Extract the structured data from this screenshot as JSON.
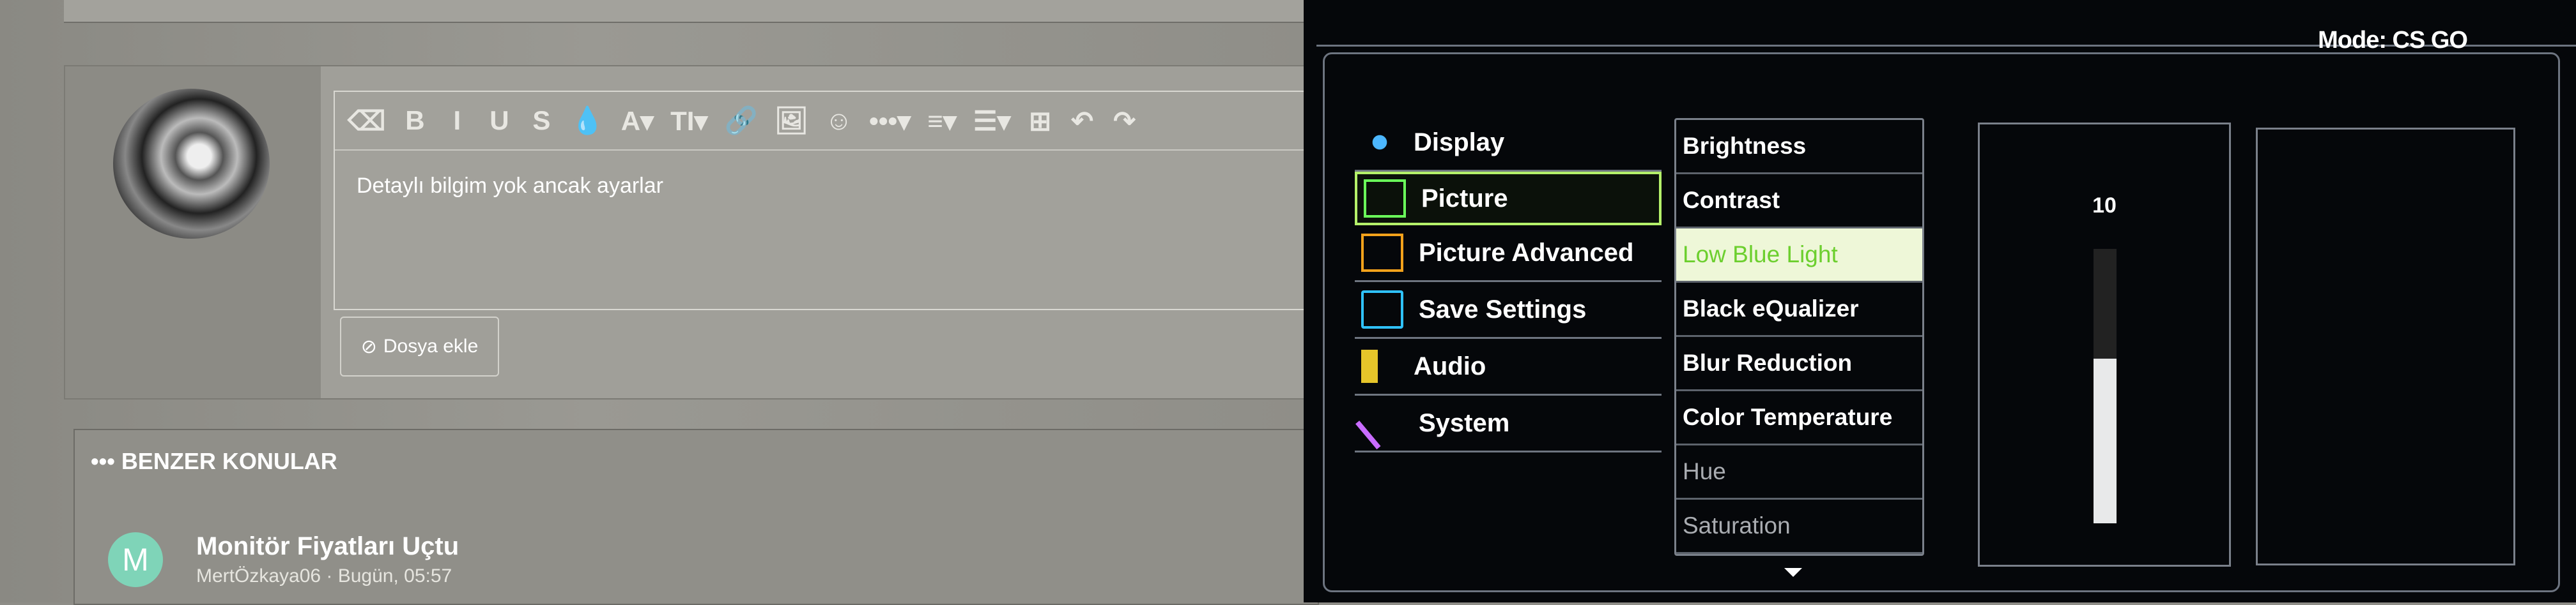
{
  "forum": {
    "editor_text": "Detaylı bilgim yok ancak ayarlar",
    "toolbar": [
      "⌫",
      "B",
      "I",
      "U",
      "S",
      "💧",
      "A▾",
      "TI▾",
      "🔗",
      "🖼",
      "☺",
      "•••▾",
      "≡▾",
      "☰▾",
      "⊞",
      "↶",
      "↷"
    ],
    "attach_label": "Dosya ekle",
    "similar_title": "••• BENZER KONULAR",
    "thread": {
      "avatar_letter": "M",
      "title": "Monitör Fiyatları Uçtu",
      "meta": "MertÖzkaya06 · Bugün, 05:57"
    }
  },
  "osd": {
    "mode": "Mode: CS GO",
    "menu": [
      "Display",
      "Picture",
      "Picture Advanced",
      "Save Settings",
      "Audio",
      "System"
    ],
    "submenu": [
      "Brightness",
      "Contrast",
      "Low Blue Light",
      "Black eQualizer",
      "Blur Reduction",
      "Color Temperature",
      "Hue",
      "Saturation"
    ],
    "value": "10",
    "value_fraction": 0.6
  }
}
